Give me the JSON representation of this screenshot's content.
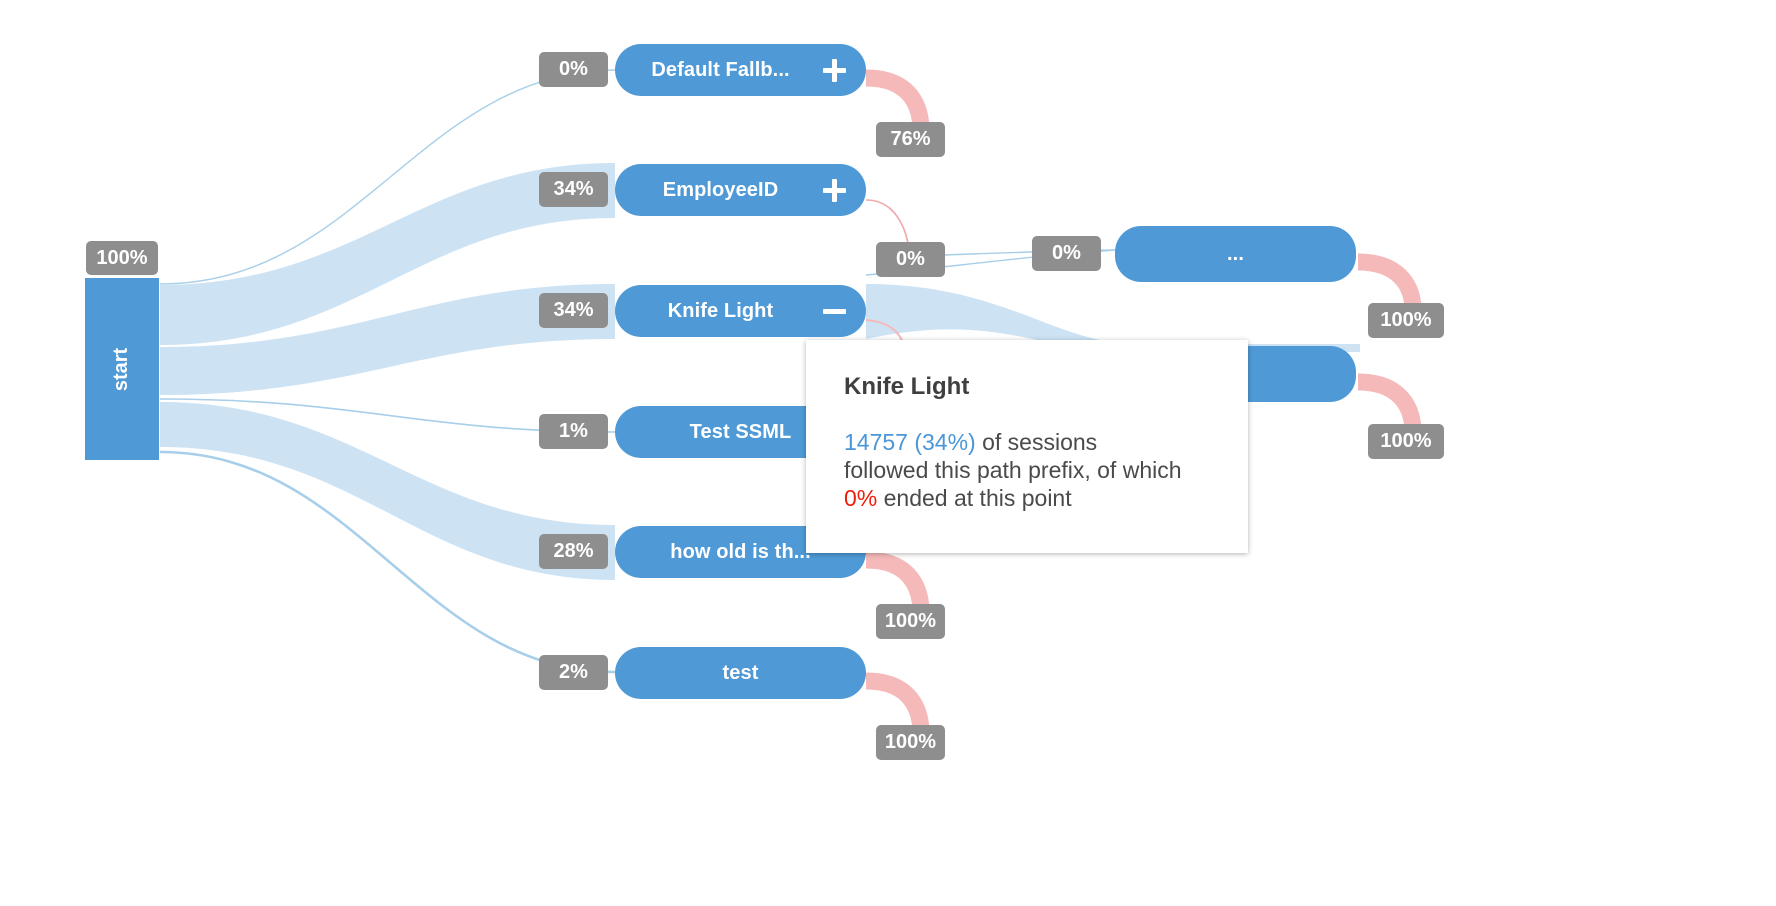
{
  "diagram": {
    "type": "sankey-path-flow",
    "title": "",
    "colors": {
      "node": "#4f9ad6",
      "flow": "#cde3f4",
      "dropoff": "#f5b9b9",
      "badge": "#8e8e8e",
      "badge_text": "#ffffff",
      "tooltip_bg": "#ffffff",
      "tooltip_count": "#4a96d8",
      "tooltip_end": "#ef1d0b",
      "background": "#ffffff"
    }
  },
  "start": {
    "label": "start",
    "badge": "100%"
  },
  "nodes": [
    {
      "label": "Default Fallb...",
      "in_badge": "0%",
      "toggle": "plus",
      "toggle_icon": "plus-icon",
      "dropoff_badge": "76%"
    },
    {
      "label": "EmployeeID",
      "in_badge": "34%",
      "toggle": "plus",
      "toggle_icon": "plus-icon",
      "dropoff_badge": "0%"
    },
    {
      "label": "Knife Light",
      "in_badge": "34%",
      "toggle": "minus",
      "toggle_icon": "minus-icon",
      "dropoff_badge": ""
    },
    {
      "label": "Test SSML",
      "in_badge": "1%",
      "toggle": "none",
      "toggle_icon": "",
      "dropoff_badge": ""
    },
    {
      "label": "how old is th...",
      "in_badge": "28%",
      "toggle": "none",
      "toggle_icon": "",
      "dropoff_badge": "100%"
    },
    {
      "label": "test",
      "in_badge": "2%",
      "toggle": "none",
      "toggle_icon": "",
      "dropoff_badge": "100%"
    }
  ],
  "level3": [
    {
      "label": "...",
      "in_badge_left": "0%",
      "in_badge_right": "0%",
      "dropoff_badge": "100%"
    },
    {
      "label": "",
      "in_badge_left": "",
      "in_badge_right": "",
      "dropoff_badge": "100%"
    }
  ],
  "tooltip": {
    "title": "Knife Light",
    "count_text": "14757 (34%)",
    "line1_rest": " of sessions",
    "line2": "followed this path prefix, of which",
    "end_pct": "0%",
    "line3_rest": " ended at this point"
  },
  "chart_data": {
    "type": "sankey",
    "title": "Session path flow",
    "root": {
      "name": "start",
      "value_pct": 100
    },
    "links": [
      {
        "source": "start",
        "target": "Default Fallb...",
        "pct": 0
      },
      {
        "source": "start",
        "target": "EmployeeID",
        "pct": 34
      },
      {
        "source": "start",
        "target": "Knife Light",
        "pct": 34
      },
      {
        "source": "start",
        "target": "Test SSML",
        "pct": 1
      },
      {
        "source": "start",
        "target": "how old is th...",
        "pct": 28
      },
      {
        "source": "start",
        "target": "test",
        "pct": 2
      },
      {
        "source": "EmployeeID",
        "target": "dropoff",
        "pct": 0
      },
      {
        "source": "Knife Light",
        "target": "...",
        "pct": 0
      },
      {
        "source": "Default Fallb...",
        "target": "dropoff",
        "pct": 76
      },
      {
        "source": "how old is th...",
        "target": "dropoff",
        "pct": 100
      },
      {
        "source": "test",
        "target": "dropoff",
        "pct": 100
      },
      {
        "source": "...",
        "target": "dropoff",
        "pct": 100
      }
    ],
    "selected_node": {
      "name": "Knife Light",
      "sessions": 14757,
      "pct": 34,
      "ended_pct": 0
    }
  }
}
